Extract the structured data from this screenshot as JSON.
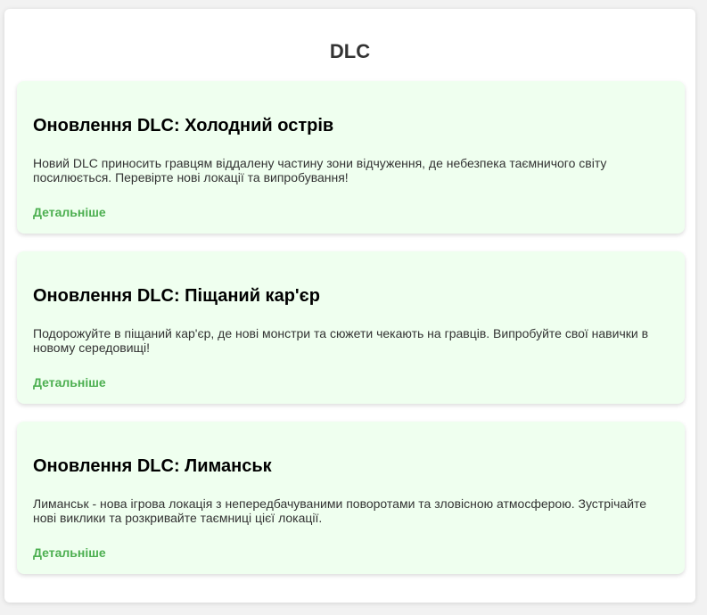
{
  "page": {
    "title": "DLC"
  },
  "colors": {
    "card_background": "#efffef",
    "link": "#4caf50",
    "title": "#333333"
  },
  "cards": [
    {
      "title": "Оновлення DLC: Холодний острів",
      "text": "Новий DLC приносить гравцям віддалену частину зони відчуження, де небезпека таємничого світу посилюється. Перевірте нові локації та випробування!",
      "link": "Детальніше"
    },
    {
      "title": "Оновлення DLC: Піщаний кар'єр",
      "text": "Подорожуйте в піщаний кар'єр, де нові монстри та сюжети чекають на гравців. Випробуйте свої навички в новому середовищі!",
      "link": "Детальніше"
    },
    {
      "title": "Оновлення DLC: Лиманськ",
      "text": "Лиманськ - нова ігрова локація з непередбачуваними поворотами та зловісною атмосферою. Зустрічайте нові виклики та розкривайте таємниці цієї локації.",
      "link": "Детальніше"
    }
  ]
}
